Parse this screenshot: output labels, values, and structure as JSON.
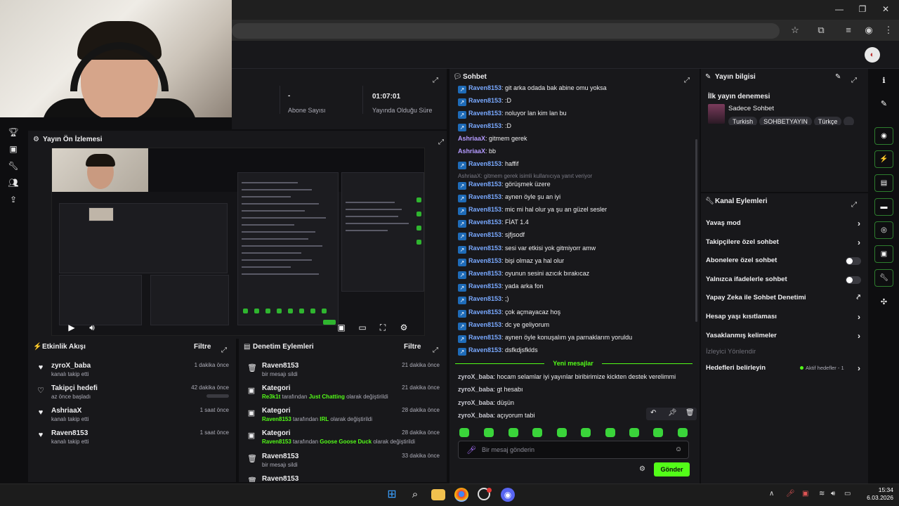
{
  "stats": {
    "subs_value": "-",
    "subs_label": "Abone Sayısı",
    "uptime_value": "01:07:01",
    "uptime_label": "Yayında Olduğu Süre"
  },
  "preview": {
    "title": "Yayın Ön İzlemesi"
  },
  "events": {
    "title": "Etkinlik Akışı",
    "filter": "Filtre",
    "items": [
      {
        "name": "zyroX_baba",
        "sub": "kanalı takip etti",
        "time": "1 dakika önce",
        "icon": "heart-icon"
      },
      {
        "name": "Takipçi hedefi",
        "sub": "az önce başladı",
        "time": "42 dakika önce",
        "icon": "heart-outline-icon"
      },
      {
        "name": "AshriaaX",
        "sub": "kanalı takip etti",
        "time": "1 saat önce",
        "icon": "heart-icon"
      },
      {
        "name": "Raven8153",
        "sub": "kanalı takip etti",
        "time": "1 saat önce",
        "icon": "heart-icon"
      }
    ]
  },
  "moderation": {
    "title": "Denetim Eylemleri",
    "filter": "Filtre",
    "items": [
      {
        "name": "Raven8153",
        "time": "21 dakika önce",
        "sub_plain": "bir mesajı sildi",
        "icon": "trash-icon"
      },
      {
        "name": "Kategori",
        "time": "21 dakika önce",
        "user": "Re3k1t",
        "mid": " tarafından ",
        "cat": "Just Chatting",
        "tail": " olarak değiştirildi",
        "icon": "category-icon"
      },
      {
        "name": "Kategori",
        "time": "28 dakika önce",
        "user": "Raven8153",
        "mid": " tarafından ",
        "cat": "IRL",
        "tail": " olarak değiştirildi",
        "icon": "category-icon"
      },
      {
        "name": "Kategori",
        "time": "28 dakika önce",
        "user": "Raven8153",
        "mid": " tarafından ",
        "cat": "Goose Goose Duck",
        "tail": " olarak değiştirildi",
        "icon": "category-icon"
      },
      {
        "name": "Raven8153",
        "time": "33 dakika önce",
        "sub_plain": "bir mesajı sildi",
        "icon": "trash-icon"
      },
      {
        "name": "Raven8153",
        "time": "",
        "sub_plain": "",
        "icon": "trash-icon"
      }
    ]
  },
  "chat": {
    "title": "Sohbet",
    "messages": [
      {
        "user": "Raven8153",
        "text": ": git arka odada bak abine omu yoksa",
        "color": "blue",
        "badge": true
      },
      {
        "user": "Raven8153",
        "text": ": :D",
        "color": "blue",
        "badge": true
      },
      {
        "user": "Raven8153",
        "text": ": noluyor lan kim lan bu",
        "color": "blue",
        "badge": true
      },
      {
        "user": "Raven8153",
        "text": ": :D",
        "color": "blue",
        "badge": true
      },
      {
        "user": "AshriaaX",
        "text": ": gitmem gerek",
        "color": "purple",
        "badge": false
      },
      {
        "user": "AshriaaX",
        "text": ": bb",
        "color": "purple",
        "badge": false
      },
      {
        "user": "Raven8153",
        "text": ": haffif",
        "color": "blue",
        "badge": true
      },
      {
        "user": "Raven8153",
        "text": ": görüşmek üzere",
        "color": "blue",
        "badge": true
      },
      {
        "user": "Raven8153",
        "text": ": aynen öyle şu an iyi",
        "color": "blue",
        "badge": true
      },
      {
        "user": "Raven8153",
        "text": ": mic mi hal olur ya şu an güzel sesler",
        "color": "blue",
        "badge": true
      },
      {
        "user": "Raven8153",
        "text": ": FİAT 1.4",
        "color": "blue",
        "badge": true
      },
      {
        "user": "Raven8153",
        "text": ": sjfjsodf",
        "color": "blue",
        "badge": true
      },
      {
        "user": "Raven8153",
        "text": ": sesi var etkisi yok gitmiyorr amw",
        "color": "blue",
        "badge": true
      },
      {
        "user": "Raven8153",
        "text": ": bişi olmaz ya hal olur",
        "color": "blue",
        "badge": true
      },
      {
        "user": "Raven8153",
        "text": ": oyunun sesini azıcık bırakıcaz",
        "color": "blue",
        "badge": true
      },
      {
        "user": "Raven8153",
        "text": ": yada arka fon",
        "color": "blue",
        "badge": true
      },
      {
        "user": "Raven8153",
        "text": ": ;)",
        "color": "blue",
        "badge": true
      },
      {
        "user": "Raven8153",
        "text": ": çok açmayacaz hoş",
        "color": "blue",
        "badge": true
      },
      {
        "user": "Raven8153",
        "text": ": dc ye geliyorum",
        "color": "blue",
        "badge": true
      },
      {
        "user": "Raven8153",
        "text": ": aynen öyle konuşalım ya parnaklarım yoruldu",
        "color": "blue",
        "badge": true
      },
      {
        "user": "Raven8153",
        "text": ": dsfkdjsfklds",
        "color": "blue",
        "badge": true
      }
    ],
    "reply_note": "AshriaaX: gitmem gerek isimli kullanıcıya yanıt veriyor",
    "new_messages_label": "Yeni mesajlar",
    "new_messages": [
      {
        "user": "zyroX_baba",
        "text": ": hocam selamlar iyi yayınlar biribirimize kickten destek verelimmi"
      },
      {
        "user": "zyroX_baba",
        "text": ": gt hesabı"
      },
      {
        "user": "zyroX_baba",
        "text": ": düşün"
      },
      {
        "user": "zyroX_baba",
        "text": ": açıyorum tabi"
      }
    ],
    "input_placeholder": "Bir mesaj gönderin",
    "send_label": "Gönder"
  },
  "info": {
    "title": "Yayın bilgisi",
    "stream_title": "İlk yayın denemesi",
    "category": "Sadece Sohbet",
    "tags": [
      "Turkish",
      "SOHBETYAYIN",
      "Türkçe"
    ]
  },
  "actions": {
    "title": "Kanal Eylemleri",
    "slow_mode": "Yavaş mod",
    "followers_only": "Takipçilere özel sohbet",
    "subs_only": "Abonelere özel sohbet",
    "emotes_only": "Yalnızca ifadelerle sohbet",
    "ai_moderation": "Yapay Zeka ile Sohbet Denetimi",
    "age_limit": "Hesap yaşı kısıtlaması",
    "banned_words": "Yasaklanmış kelimeler",
    "raid": "İzleyici Yönlendir",
    "goals": "Hedefleri belirleyin",
    "goals_status": "Aktif hedefler - 1"
  },
  "taskbar": {
    "time": "15:34",
    "date": "6.03.2026"
  },
  "colors": {
    "accent": "#53fc18",
    "panel": "#18181b",
    "background": "#0e0e10"
  }
}
